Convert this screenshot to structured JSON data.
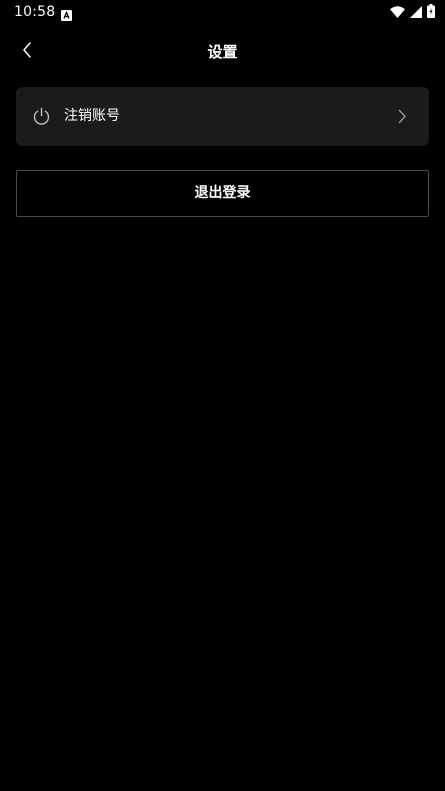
{
  "status_bar": {
    "time": "10:58",
    "notification_icon": "a-letter-icon",
    "icons": [
      "wifi-icon",
      "cell-signal-icon",
      "battery-icon"
    ]
  },
  "header": {
    "title": "设置",
    "back_icon": "chevron-left-icon"
  },
  "menu": {
    "items": [
      {
        "label": "注销账号",
        "icon": "power-icon",
        "trailing_icon": "chevron-right-icon"
      }
    ]
  },
  "logout": {
    "label": "退出登录"
  },
  "colors": {
    "background": "#000000",
    "card": "#1b1b1b",
    "border": "#4a4a4a",
    "text": "#ffffff",
    "muted_icon": "#bdbdbd"
  }
}
